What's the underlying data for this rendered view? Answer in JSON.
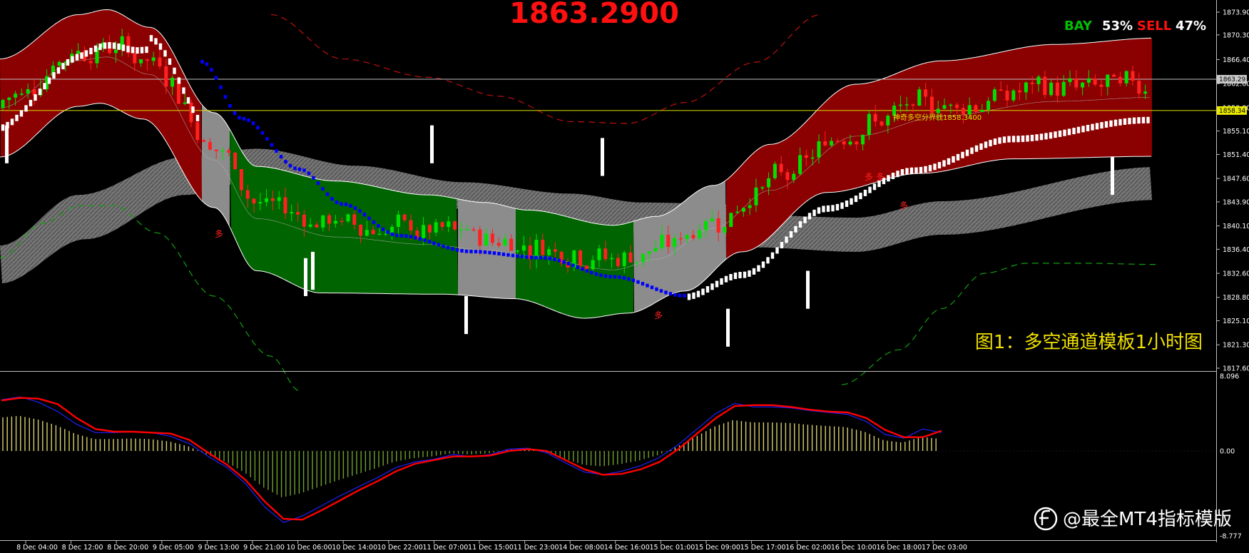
{
  "header": {
    "price": "1863.2900",
    "bay_label": "BAY",
    "bay_pct": "53%",
    "sell_label": "SELL",
    "sell_pct": "47%"
  },
  "annotation": {
    "caption": "图1：多空通道模板1小时图",
    "boundary_label": "神奇多空分界线1858.3400",
    "duo": "多"
  },
  "watermark": {
    "text": "@最全MT4指标模版"
  },
  "colors": {
    "bull_candle": "#00e000",
    "bear_candle": "#ff2020",
    "channel_red": "#8b0000",
    "channel_green": "#006400",
    "channel_gray": "#8c8c8c",
    "trend_blue": "#0000ff",
    "price_line": "#c0c0c0",
    "boundary_line": "#e0e000",
    "bay_green": "#00c000",
    "sell_red": "#ff1010",
    "macd_signal": "#ff0000",
    "macd_main": "#2020ff",
    "hist_pos": "#d8d070",
    "hist_neg": "#70a030"
  },
  "chart_data": {
    "type": "candlestick",
    "title": "",
    "price_axis": {
      "ticks": [
        "1873.90",
        "1870.30",
        "1866.40",
        "1862.60",
        "1858.80",
        "1855.10",
        "1851.40",
        "1847.60",
        "1843.90",
        "1840.10",
        "1836.40",
        "1832.60",
        "1828.80",
        "1825.10",
        "1821.30",
        "1817.60"
      ],
      "ylim": [
        1817.6,
        1875.2
      ],
      "current_price": "1863.29",
      "boundary_price": "1858.34"
    },
    "time_axis": {
      "labels": [
        "8 Dec 04:00",
        "8 Dec 12:00",
        "8 Dec 20:00",
        "9 Dec 05:00",
        "9 Dec 13:00",
        "9 Dec 21:00",
        "10 Dec 06:00",
        "10 Dec 14:00",
        "10 Dec 22:00",
        "11 Dec 07:00",
        "11 Dec 15:00",
        "11 Dec 23:00",
        "14 Dec 08:00",
        "14 Dec 16:00",
        "15 Dec 01:00",
        "15 Dec 09:00",
        "15 Dec 17:00",
        "16 Dec 02:00",
        "16 Dec 10:00",
        "16 Dec 18:00",
        "17 Dec 03:00"
      ]
    },
    "channel_segments": [
      {
        "state": "bear",
        "color": "red",
        "from_label": "8 Dec 04:00",
        "to_label": "9 Dec 13:00"
      },
      {
        "state": "neutral",
        "color": "gray",
        "from_label": "9 Dec 13:00",
        "to_label": "9 Dec 17:00"
      },
      {
        "state": "bull",
        "color": "green",
        "from_label": "9 Dec 17:00",
        "to_label": "11 Dec 15:00"
      },
      {
        "state": "neutral",
        "color": "gray",
        "from_label": "11 Dec 15:00",
        "to_label": "11 Dec 23:00"
      },
      {
        "state": "bull",
        "color": "green",
        "from_label": "11 Dec 23:00",
        "to_label": "14 Dec 16:00"
      },
      {
        "state": "neutral",
        "color": "gray",
        "from_label": "14 Dec 16:00",
        "to_label": "15 Dec 09:00"
      },
      {
        "state": "bear",
        "color": "red",
        "from_label": "15 Dec 09:00",
        "to_label": "17 Dec 03:00"
      }
    ],
    "macd": {
      "ticks": [
        "8.096",
        "0.00",
        "-8.777"
      ],
      "ylim": [
        -8.777,
        8.096
      ],
      "main": [
        5.6,
        5.9,
        5.3,
        4.3,
        2.9,
        2.0,
        2.0,
        2.1,
        2.0,
        1.6,
        0.8,
        -0.6,
        -1.8,
        -3.6,
        -6.1,
        -7.8,
        -7.1,
        -6.0,
        -4.9,
        -3.9,
        -2.9,
        -1.8,
        -1.2,
        -0.9,
        -0.4,
        -0.6,
        -0.4,
        0.2,
        0.3,
        -0.2,
        -1.3,
        -2.3,
        -2.6,
        -2.2,
        -1.6,
        -0.7,
        0.7,
        2.4,
        4.1,
        5.2,
        4.8,
        4.8,
        4.7,
        4.4,
        4.2,
        4.0,
        3.2,
        1.8,
        1.4,
        2.4,
        2.0
      ],
      "signal": [
        5.5,
        5.8,
        5.7,
        5.1,
        3.6,
        2.4,
        2.1,
        2.1,
        2.0,
        1.9,
        1.2,
        -0.2,
        -1.5,
        -3.2,
        -5.5,
        -7.4,
        -7.5,
        -6.5,
        -5.4,
        -4.3,
        -3.3,
        -2.2,
        -1.4,
        -1.0,
        -0.6,
        -0.6,
        -0.5,
        0.0,
        0.2,
        0.0,
        -1.0,
        -2.0,
        -2.6,
        -2.5,
        -2.0,
        -1.2,
        0.2,
        1.9,
        3.6,
        4.9,
        5.0,
        5.0,
        4.8,
        4.5,
        4.3,
        4.2,
        3.6,
        2.3,
        1.5,
        1.5,
        2.2
      ]
    }
  }
}
